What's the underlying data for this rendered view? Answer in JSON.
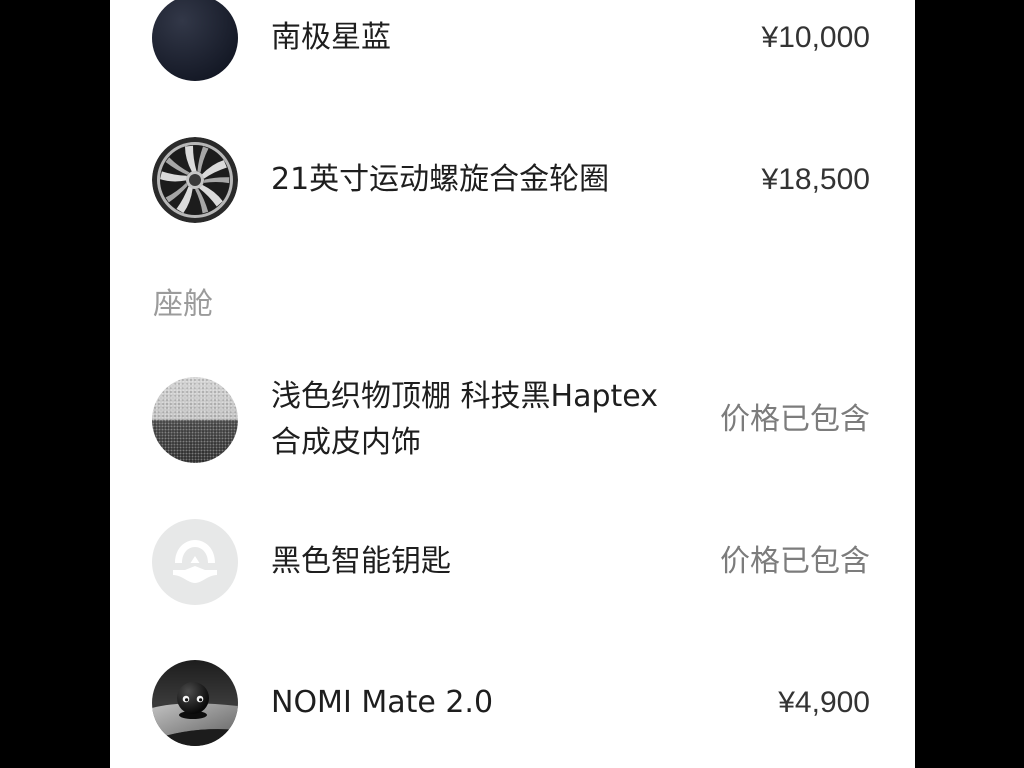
{
  "exterior_options": [
    {
      "name": "南极星蓝",
      "price": "¥10,000",
      "icon": "paint-color-swatch",
      "swatch_color": "#1b2133"
    },
    {
      "name": "21英寸运动螺旋合金轮圈",
      "price": "¥18,500",
      "icon": "alloy-wheel-icon"
    }
  ],
  "cabin": {
    "title": "座舱",
    "options": [
      {
        "name": "浅色织物顶棚 科技黑Haptex合成皮内饰",
        "price": "价格已包含",
        "icon": "interior-material-swatch"
      },
      {
        "name": "黑色智能钥匙",
        "price": "价格已包含",
        "icon": "nio-logo-key-icon",
        "swatch_color": "#e7e8e8"
      },
      {
        "name": "NOMI Mate 2.0",
        "price": "¥4,900",
        "icon": "nomi-mate-icon"
      }
    ]
  }
}
